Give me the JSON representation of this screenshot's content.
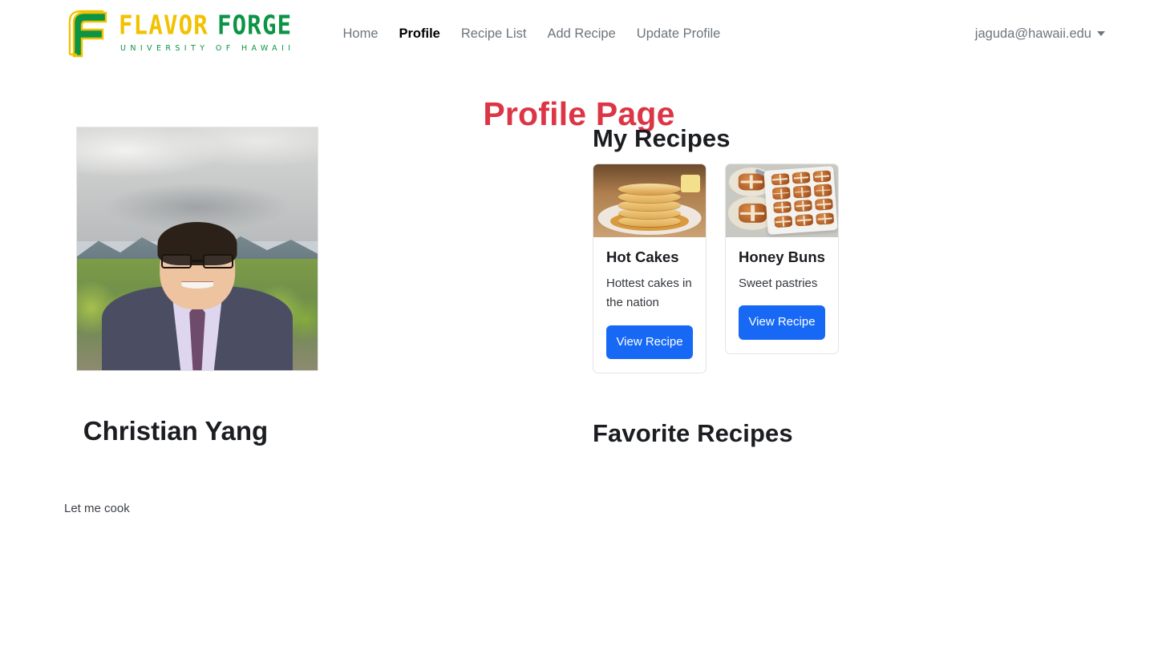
{
  "navbar": {
    "brand": {
      "logo_icon": "flavor-forge-f-logo",
      "word_primary": "FLAVOR",
      "word_secondary": "FORGE",
      "subtitle": "UNIVERSITY OF HAWAII",
      "color_yellow": "#F2C201",
      "color_green": "#0B9444"
    },
    "links": [
      {
        "label": "Home",
        "active": false
      },
      {
        "label": "Profile",
        "active": true
      },
      {
        "label": "Recipe List",
        "active": false
      },
      {
        "label": "Add Recipe",
        "active": false
      },
      {
        "label": "Update Profile",
        "active": false
      }
    ],
    "user": {
      "email": "jaguda@hawaii.edu",
      "caret_icon": "chevron-down-icon"
    }
  },
  "page": {
    "title": "Profile Page",
    "title_color": "#DC3545"
  },
  "profile": {
    "avatar_alt": "profile-photo",
    "name": "Christian Yang",
    "bio": "Let me cook"
  },
  "sections": {
    "my_recipes_heading": "My Recipes",
    "favorite_recipes_heading": "Favorite Recipes"
  },
  "my_recipes": [
    {
      "title": "Hot Cakes",
      "description": "Hottest cakes in the nation",
      "button_label": "View Recipe",
      "image_alt": "stack-of-pancakes-photo",
      "button_color": "#1769F5"
    },
    {
      "title": "Honey Buns",
      "description": "Sweet pastries",
      "button_label": "View Recipe",
      "image_alt": "hot-cross-buns-photo",
      "button_color": "#1769F5"
    }
  ],
  "favorite_recipes": []
}
